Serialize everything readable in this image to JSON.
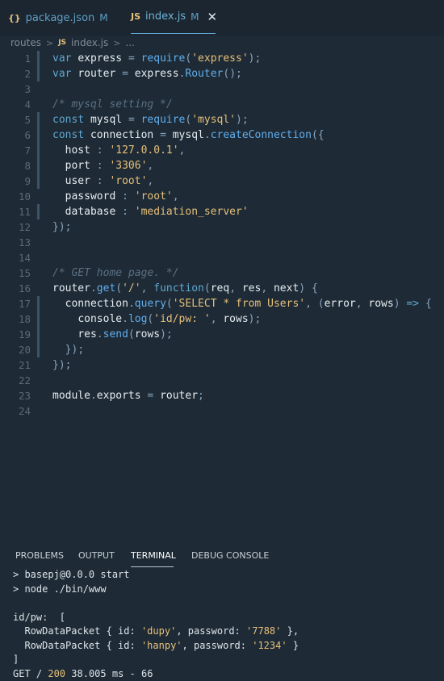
{
  "tabs": [
    {
      "icon": "{}",
      "name": "package.json",
      "status": "M"
    },
    {
      "icon": "JS",
      "name": "index.js",
      "status": "M",
      "close": "✕"
    }
  ],
  "breadcrumb": {
    "folder": "routes",
    "sep": ">",
    "icon": "JS",
    "file": "index.js",
    "more": "..."
  },
  "editor": {
    "line_numbers": [
      "1",
      "2",
      "3",
      "4",
      "5",
      "6",
      "7",
      "8",
      "9",
      "10",
      "11",
      "12",
      "13",
      "14",
      "15",
      "16",
      "17",
      "18",
      "19",
      "20",
      "21",
      "22",
      "23",
      "24"
    ],
    "lines": [
      "var express = require('express');",
      "var router = express.Router();",
      "",
      "/* mysql setting */",
      "const mysql = require('mysql');",
      "const connection = mysql.createConnection({",
      "  host : '127.0.0.1',",
      "  port : '3306',",
      "  user : 'root',",
      "  password : 'root',",
      "  database : 'mediation_server'",
      "});",
      "",
      "",
      "/* GET home page. */",
      "router.get('/', function(req, res, next) {",
      "  connection.query('SELECT * from Users', (error, rows) => {",
      "    console.log('id/pw: ', rows);",
      "    res.send(rows);",
      "  });",
      "});",
      "",
      "module.exports = router;",
      ""
    ]
  },
  "panel": {
    "tabs": [
      "PROBLEMS",
      "OUTPUT",
      "TERMINAL",
      "DEBUG CONSOLE"
    ],
    "active_tab": "TERMINAL",
    "terminal_lines": [
      "> basepj@0.0.0 start",
      "> node ./bin/www",
      "",
      "id/pw:  [",
      "  RowDataPacket { id: 'dupy', password: '7788' },",
      "  RowDataPacket { id: 'hanpy', password: '1234' }",
      "]",
      "GET / 200 38.005 ms - 66"
    ]
  },
  "colors": {
    "accent": "#5fa8d3",
    "string": "#e5c07b",
    "keyword": "#c678dd",
    "background": "#1e2a35"
  }
}
